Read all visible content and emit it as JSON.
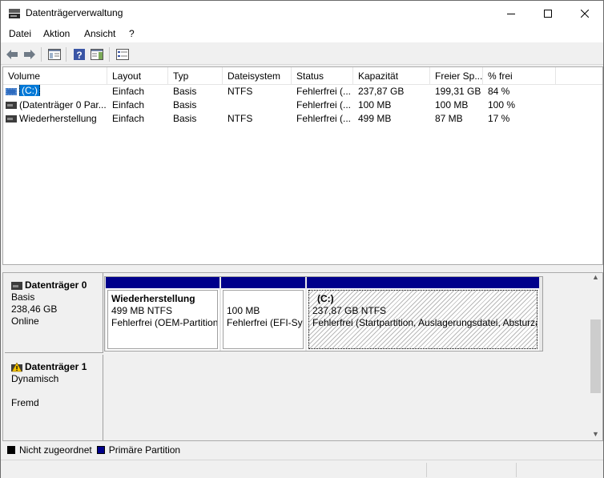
{
  "window": {
    "title": "Datenträgerverwaltung"
  },
  "menu": {
    "items": [
      {
        "label": "Datei"
      },
      {
        "label": "Aktion"
      },
      {
        "label": "Ansicht"
      },
      {
        "label": "?"
      }
    ]
  },
  "toolbar": {
    "buttons": [
      "back-icon",
      "forward-icon",
      "console-tree-icon",
      "help-icon",
      "action-pane-icon",
      "properties-icon"
    ]
  },
  "volume_list": {
    "columns": [
      "Volume",
      "Layout",
      "Typ",
      "Dateisystem",
      "Status",
      "Kapazität",
      "Freier Sp...",
      "% frei"
    ],
    "rows": [
      {
        "volume": "(C:)",
        "layout": "Einfach",
        "typ": "Basis",
        "dateisystem": "NTFS",
        "status": "Fehlerfrei (...",
        "kapazitaet": "237,87 GB",
        "frei": "199,31 GB",
        "prozent": "84 %",
        "selected": true
      },
      {
        "volume": "(Datenträger 0 Par...",
        "layout": "Einfach",
        "typ": "Basis",
        "dateisystem": "",
        "status": "Fehlerfrei (...",
        "kapazitaet": "100 MB",
        "frei": "100 MB",
        "prozent": "100 %",
        "selected": false
      },
      {
        "volume": "Wiederherstellung",
        "layout": "Einfach",
        "typ": "Basis",
        "dateisystem": "NTFS",
        "status": "Fehlerfrei (...",
        "kapazitaet": "499 MB",
        "frei": "87 MB",
        "prozent": "17 %",
        "selected": false
      }
    ]
  },
  "disks": [
    {
      "name": "Datenträger 0",
      "type": "Basis",
      "size": "238,46 GB",
      "state": "Online",
      "partitions": [
        {
          "name": "Wiederherstellung",
          "size": "499 MB NTFS",
          "status": "Fehlerfrei (OEM-Partition)"
        },
        {
          "name": "",
          "size": "100 MB",
          "status": "Fehlerfrei (EFI-Systempartition)"
        },
        {
          "name": "(C:)",
          "size": "237,87 GB NTFS",
          "status": "Fehlerfrei (Startpartition, Auslagerungsdatei, Absturzabbild, Primäre Partition)"
        }
      ]
    },
    {
      "name": "Datenträger 1",
      "type": "Dynamisch",
      "size": "",
      "state": "Fremd",
      "partitions": []
    }
  ],
  "legend": {
    "items": [
      {
        "label": "Nicht zugeordnet",
        "color": "#000000"
      },
      {
        "label": "Primäre Partition",
        "color": "#00008b"
      }
    ]
  },
  "colors": {
    "partition_bar": "#00008b",
    "selection": "#0078d7",
    "warning": "#f5c400"
  }
}
